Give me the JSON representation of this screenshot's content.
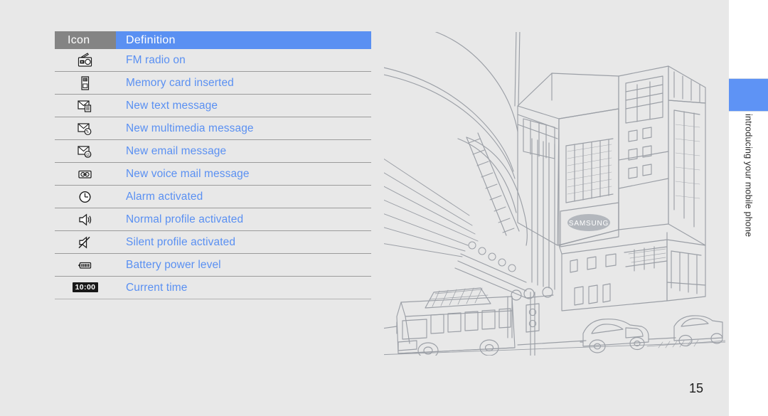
{
  "page": {
    "background_color": "#e8e8e8",
    "page_number": "15",
    "side_tab_color": "#5e93f5",
    "side_label": "introducing your mobile phone"
  },
  "table": {
    "header_icon_bg": "#848484",
    "header_def_bg": "#5a90f2",
    "text_color": "#5a90f2",
    "columns": [
      "Icon",
      "Definition"
    ],
    "rows": [
      {
        "icon": "fm-radio-icon",
        "definition": "FM radio on"
      },
      {
        "icon": "memory-card-icon",
        "definition": "Memory card inserted"
      },
      {
        "icon": "new-text-message-icon",
        "definition": "New text message"
      },
      {
        "icon": "new-multimedia-message-icon",
        "definition": "New multimedia message"
      },
      {
        "icon": "new-email-message-icon",
        "definition": "New email message"
      },
      {
        "icon": "new-voice-mail-icon",
        "definition": "New voice mail message"
      },
      {
        "icon": "alarm-clock-icon",
        "definition": "Alarm activated"
      },
      {
        "icon": "speaker-normal-icon",
        "definition": "Normal profile activated"
      },
      {
        "icon": "speaker-muted-icon",
        "definition": "Silent profile activated"
      },
      {
        "icon": "battery-icon",
        "definition": "Battery power level"
      },
      {
        "icon": "clock-time-badge",
        "definition": "Current time",
        "icon_text": "10:00"
      }
    ]
  },
  "illustration": {
    "name": "city-street-line-drawing",
    "stroke_color": "#9b9fa6",
    "sign_text": "SAMSUNG",
    "description": "Line-art drawing of an urban street with a Samsung-branded building, bus, cars and traffic lights"
  }
}
